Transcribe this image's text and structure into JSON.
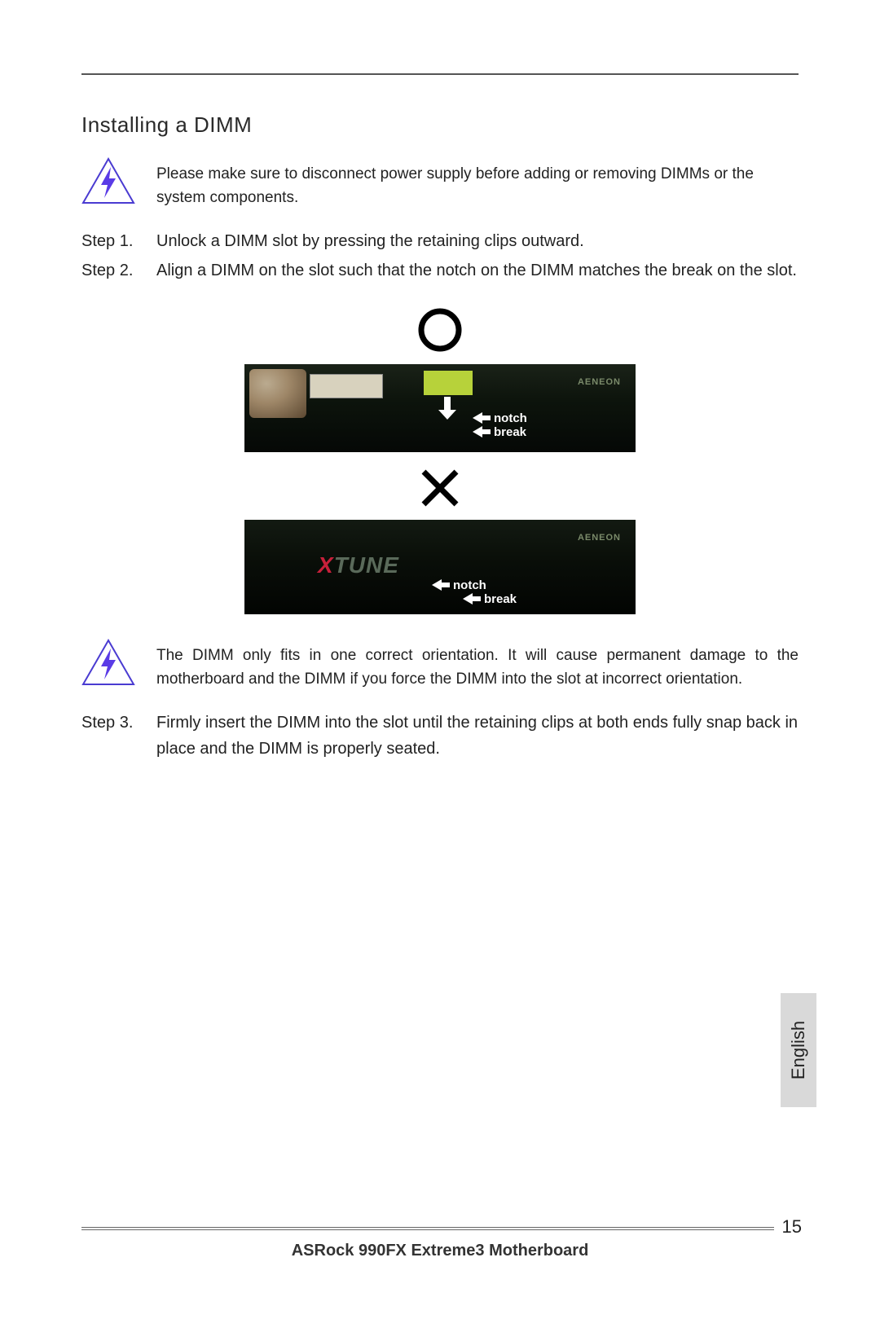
{
  "title": "Installing a DIMM",
  "warn1": "Please make sure to disconnect power supply before adding or removing DIMMs or the system components.",
  "steps_a": [
    {
      "label": "Step 1.",
      "body": "Unlock a DIMM slot by pressing the retaining clips outward."
    },
    {
      "label": "Step 2.",
      "body": "Align a DIMM on the slot such that the notch on the DIMM matches the break on the slot."
    }
  ],
  "figure": {
    "correct_labels": {
      "notch": "notch",
      "break": "break"
    },
    "incorrect_labels": {
      "notch": "notch",
      "break": "break"
    },
    "brand": "AENEON",
    "xtune_x": "X",
    "xtune_rest": "TUNE"
  },
  "warn2": "The DIMM only fits in one correct orientation. It will cause permanent damage to the motherboard and the DIMM if you force the DIMM into the slot at incorrect orientation.",
  "steps_b": [
    {
      "label": "Step 3.",
      "body": "Firmly insert the DIMM into the slot until the retaining clips at both ends fully snap back in place and the DIMM is properly seated."
    }
  ],
  "footer": {
    "page_number": "15",
    "product": "ASRock  990FX Extreme3  Motherboard"
  },
  "language_tab": "English"
}
